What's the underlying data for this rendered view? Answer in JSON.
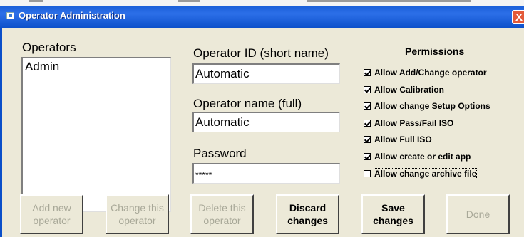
{
  "window": {
    "title": "Operator Administration",
    "close_symbol": "X"
  },
  "operators": {
    "label": "Operators",
    "items": [
      "Admin"
    ]
  },
  "operator_id": {
    "label": "Operator ID (short name)",
    "value": "Automatic"
  },
  "operator_name": {
    "label": "Operator name (full)",
    "value": "Automatic"
  },
  "password": {
    "label": "Password",
    "value": "*****"
  },
  "permissions": {
    "title": "Permissions",
    "items": [
      {
        "label": "Allow Add/Change operator",
        "checked": true
      },
      {
        "label": "Allow Calibration",
        "checked": true
      },
      {
        "label": "Allow change Setup Options",
        "checked": true
      },
      {
        "label": "Allow Pass/Fail ISO",
        "checked": true
      },
      {
        "label": "Allow Full ISO",
        "checked": true
      },
      {
        "label": "Allow create or edit app",
        "checked": true
      },
      {
        "label": "Allow change archive file",
        "checked": false
      }
    ]
  },
  "buttons": {
    "add": "Add new\noperator",
    "change": "Change this\noperator",
    "delete": "Delete this\noperator",
    "discard": "Discard\nchanges",
    "save": "Save\nchanges",
    "done": "Done"
  }
}
